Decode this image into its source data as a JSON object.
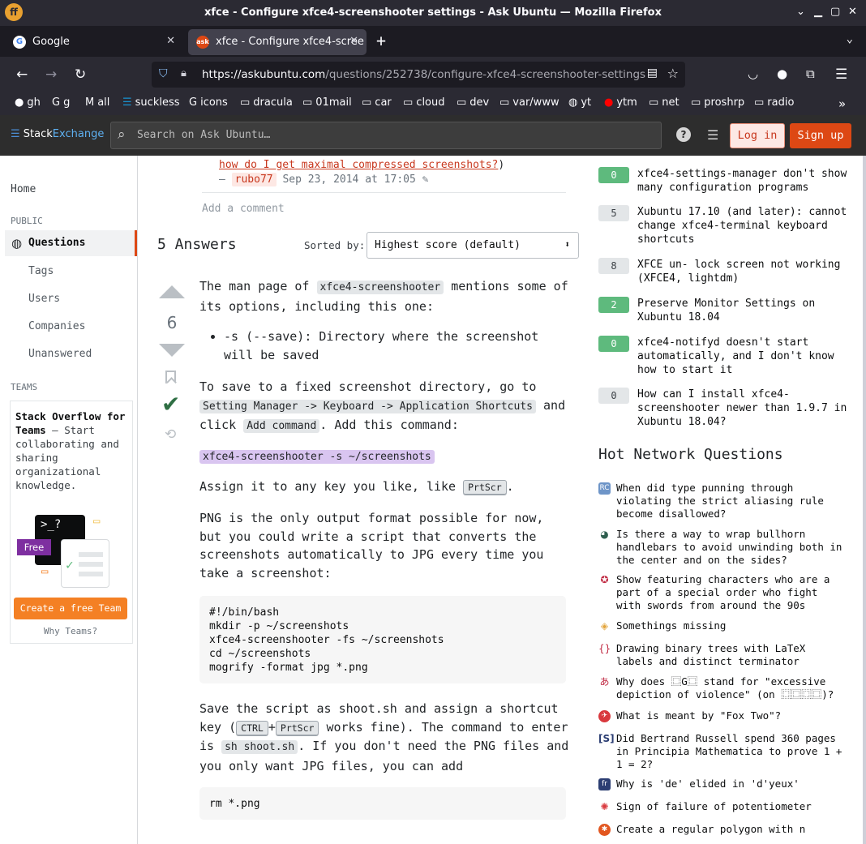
{
  "window": {
    "title": "xfce - Configure xfce4-screenshooter settings - Ask Ubuntu — Mozilla Firefox"
  },
  "tabs": [
    {
      "label": "Google"
    },
    {
      "label": "xfce - Configure xfce4-scree"
    }
  ],
  "urlbar": {
    "url_host": "https://askubuntu.com",
    "url_path": "/questions/252738/configure-xfce4-screenshooter-settings"
  },
  "bookmarks": [
    "gh",
    "g",
    "all",
    "suckless",
    "icons",
    "dracula",
    "01mail",
    "car",
    "cloud",
    "dev",
    "var/www",
    "yt",
    "ytm",
    "net",
    "proshrp",
    "radio"
  ],
  "se_header": {
    "logo_a": "Stack",
    "logo_b": "Exchange",
    "search_placeholder": "Search on Ask Ubuntu…",
    "login": "Log in",
    "signup": "Sign up"
  },
  "leftnav": {
    "home": "Home",
    "public": "PUBLIC",
    "questions": "Questions",
    "tags": "Tags",
    "users": "Users",
    "companies": "Companies",
    "unanswered": "Unanswered",
    "teams": "TEAMS",
    "teams_title": "Stack Overflow for Teams",
    "teams_desc": " – Start collaborating and sharing organizational knowledge.",
    "teams_cta": "Create a free Team",
    "why_teams": "Why Teams?",
    "free_badge": "Free",
    "prompt": ">_?"
  },
  "comment": {
    "link": "how do I get maximal compressed screenshots?",
    "close_paren": ")",
    "dash": "– ",
    "user": "rubo77",
    "date": "Sep 23, 2014 at 17:05",
    "add": "Add a comment"
  },
  "answers": {
    "heading": "5 Answers",
    "sorted_by": "Sorted by:",
    "sort_value": "Highest score (default)",
    "score": "6"
  },
  "answer": {
    "p1a": "The man page of ",
    "p1code": "xfce4-screenshooter",
    "p1b": " mentions some of its options, including this one:",
    "li1": "-s (--save): Directory where the screenshot will be saved",
    "p2a": "To save to a fixed screenshot directory, go to ",
    "p2code": "Setting Manager -> Keyboard -> Application Shortcuts",
    "p2b": " and click ",
    "p2code2": "Add command",
    "p2c": ". Add this command:",
    "cmd": "xfce4-screenshooter -s ~/screenshots",
    "p3a": "Assign it to any key you like, like ",
    "p3kbd": "PrtScr",
    "p3b": ".",
    "p4": "PNG is the only output format possible for now, but you could write a script that converts the screenshots automatically to JPG every time you take a screenshot:",
    "script": "#!/bin/bash\nmkdir -p ~/screenshots\nxfce4-screenshooter -fs ~/screenshots\ncd ~/screenshots\nmogrify -format jpg *.png",
    "p5a": "Save the script as shoot.sh and assign a shortcut key (",
    "p5kbd1": "CTRL",
    "p5plus": "+",
    "p5kbd2": "PrtScr",
    "p5b": " works fine). The command to enter is ",
    "p5code": "sh shoot.sh",
    "p5c": ". If you don't need the PNG files and you only want JPG files, you can add",
    "rm": "rm *.png"
  },
  "related": [
    {
      "score": "0",
      "title": "xfce4-settings-manager don't show many configuration programs",
      "accepted": true
    },
    {
      "score": "5",
      "title": "Xubuntu 17.10 (and later): cannot change xfce4-terminal keyboard shortcuts",
      "accepted": false
    },
    {
      "score": "8",
      "title": "XFCE un- lock screen not working (XFCE4, lightdm)",
      "accepted": false
    },
    {
      "score": "2",
      "title": "Preserve Monitor Settings on Xubuntu 18.04",
      "accepted": true
    },
    {
      "score": "0",
      "title": "xfce4-notifyd doesn't start automatically, and I don't know how to start it",
      "accepted": true
    },
    {
      "score": "0",
      "title": "How can I install xfce4-screenshooter newer than 1.9.7 in Xubuntu 18.04?",
      "accepted": false
    }
  ],
  "hnq": {
    "heading": "Hot Network Questions",
    "items": [
      {
        "icon": "retrocomputing-icon",
        "title": "When did type punning through violating the strict aliasing rule become disallowed?"
      },
      {
        "icon": "bicycles-icon",
        "title": "Is there a way to wrap bullhorn handlebars to avoid unwinding both in the center and on the sides?"
      },
      {
        "icon": "scifi-icon",
        "title": "Show featuring characters who are a part of a special order who fight with swords from around the 90s"
      },
      {
        "icon": "puzzling-icon",
        "title": "Somethings missing"
      },
      {
        "icon": "tex-icon",
        "title": "Drawing binary trees with LaTeX labels and distinct terminator"
      },
      {
        "icon": "japanese-icon",
        "title": "Why does ⿴G⿴ stand for \"excessive depiction of violence\" (on ⿴⿴⿴⿴)?"
      },
      {
        "icon": "aviation-icon",
        "title": "What is meant by \"Fox Two\"?"
      },
      {
        "icon": "philosophy-icon",
        "title": "Did Bertrand Russell spend 360 pages in Principia Mathematica to prove 1 + 1 = 2?"
      },
      {
        "icon": "french-icon",
        "title": "Why is 'de' elided in 'd'yeux'"
      },
      {
        "icon": "electronics-icon",
        "title": "Sign of failure of potentiometer"
      },
      {
        "icon": "math-icon",
        "title": "Create a regular polygon with n"
      }
    ]
  },
  "colors": {
    "accent": "#dd4814",
    "accepted": "#5eba7d",
    "header": "#2d2d2d",
    "browser": "#2b2a33"
  }
}
